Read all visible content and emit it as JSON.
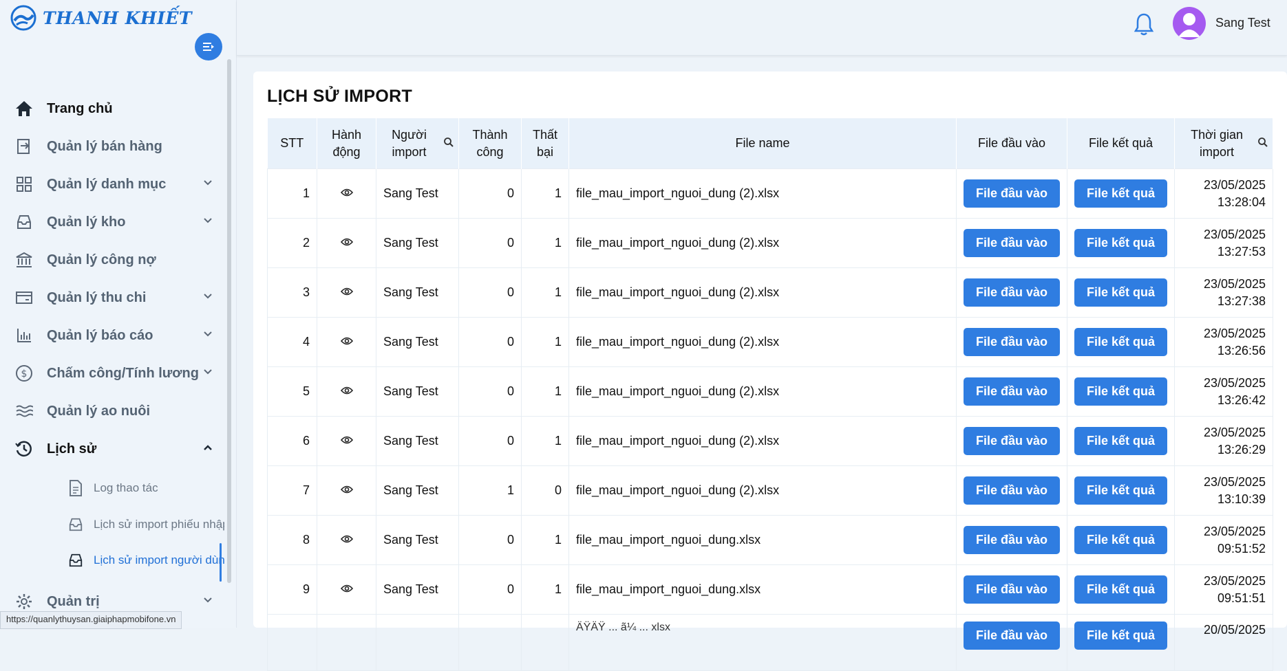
{
  "app": {
    "brand": "THANH KHIẾT"
  },
  "sidebar": {
    "items": [
      {
        "label": "Trang chủ",
        "icon": "home-icon"
      },
      {
        "label": "Quản lý bán hàng",
        "icon": "sales-icon"
      },
      {
        "label": "Quản lý danh mục",
        "icon": "grid-icon"
      },
      {
        "label": "Quản lý kho",
        "icon": "inbox-icon"
      },
      {
        "label": "Quản lý công nợ",
        "icon": "bank-icon"
      },
      {
        "label": "Quản lý thu chi",
        "icon": "card-icon"
      },
      {
        "label": "Quản lý báo cáo",
        "icon": "bar-chart-icon"
      },
      {
        "label": "Chấm công/Tính lương",
        "icon": "dollar-icon"
      },
      {
        "label": "Quản lý ao nuôi",
        "icon": "waves-icon"
      },
      {
        "label": "Lịch sử",
        "icon": "history-icon"
      },
      {
        "label": "Quản trị",
        "icon": "gear-icon"
      }
    ],
    "subitems": [
      {
        "label": "Log thao tác",
        "icon": "document-icon"
      },
      {
        "label": "Lịch sử import phiếu nhập",
        "icon": "inbox-icon"
      },
      {
        "label": "Lịch sử import người dùng",
        "icon": "inbox-icon"
      }
    ],
    "status_url": "https://quanlythuysan.giaiphapmobifone.vn"
  },
  "header": {
    "username": "Sang Test"
  },
  "page": {
    "title": "LỊCH SỬ IMPORT",
    "columns": {
      "stt": "STT",
      "action_1": "Hành",
      "action_2": "động",
      "user_1": "Người",
      "user_2": "import",
      "success_1": "Thành",
      "success_2": "công",
      "fail_1": "Thất",
      "fail_2": "bại",
      "file_name": "File name",
      "input_file": "File đầu vào",
      "result_file": "File kết quả",
      "time_1": "Thời gian",
      "time_2": "import"
    },
    "button_input": "File đầu vào",
    "button_result": "File kết quả",
    "rows": [
      {
        "stt": "1",
        "user": "Sang Test",
        "success": "0",
        "fail": "1",
        "file": "file_mau_import_nguoi_dung (2).xlsx",
        "date": "23/05/2025",
        "time": "13:28:04"
      },
      {
        "stt": "2",
        "user": "Sang Test",
        "success": "0",
        "fail": "1",
        "file": "file_mau_import_nguoi_dung (2).xlsx",
        "date": "23/05/2025",
        "time": "13:27:53"
      },
      {
        "stt": "3",
        "user": "Sang Test",
        "success": "0",
        "fail": "1",
        "file": "file_mau_import_nguoi_dung (2).xlsx",
        "date": "23/05/2025",
        "time": "13:27:38"
      },
      {
        "stt": "4",
        "user": "Sang Test",
        "success": "0",
        "fail": "1",
        "file": "file_mau_import_nguoi_dung (2).xlsx",
        "date": "23/05/2025",
        "time": "13:26:56"
      },
      {
        "stt": "5",
        "user": "Sang Test",
        "success": "0",
        "fail": "1",
        "file": "file_mau_import_nguoi_dung (2).xlsx",
        "date": "23/05/2025",
        "time": "13:26:42"
      },
      {
        "stt": "6",
        "user": "Sang Test",
        "success": "0",
        "fail": "1",
        "file": "file_mau_import_nguoi_dung (2).xlsx",
        "date": "23/05/2025",
        "time": "13:26:29"
      },
      {
        "stt": "7",
        "user": "Sang Test",
        "success": "1",
        "fail": "0",
        "file": "file_mau_import_nguoi_dung (2).xlsx",
        "date": "23/05/2025",
        "time": "13:10:39"
      },
      {
        "stt": "8",
        "user": "Sang Test",
        "success": "0",
        "fail": "1",
        "file": "file_mau_import_nguoi_dung.xlsx",
        "date": "23/05/2025",
        "time": "09:51:52"
      },
      {
        "stt": "9",
        "user": "Sang Test",
        "success": "0",
        "fail": "1",
        "file": "file_mau_import_nguoi_dung.xlsx",
        "date": "23/05/2025",
        "time": "09:51:51"
      }
    ],
    "partial_row": {
      "file": "ÄŸÄŸ ... ã¼ ... xlsx",
      "date": "20/05/2025"
    }
  }
}
